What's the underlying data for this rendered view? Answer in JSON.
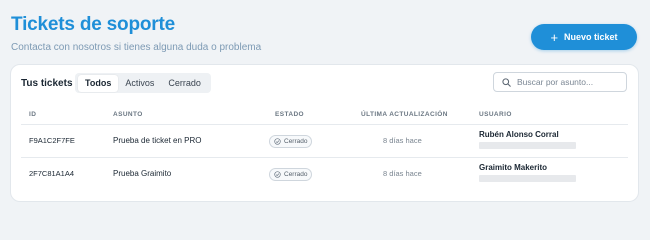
{
  "header": {
    "title": "Tickets de soporte",
    "subtitle": "Contacta con nosotros si tienes alguna duda o problema",
    "new_ticket_label": "Nuevo ticket"
  },
  "card": {
    "title": "Tus tickets",
    "tabs": [
      {
        "label": "Todos",
        "active": true
      },
      {
        "label": "Activos",
        "active": false
      },
      {
        "label": "Cerrado",
        "active": false
      }
    ],
    "search": {
      "placeholder": "Buscar por asunto...",
      "value": ""
    }
  },
  "table": {
    "columns": [
      "ID",
      "ASUNTO",
      "ESTADO",
      "ÚLTIMA ACTUALIZACIÓN",
      "USUARIO"
    ],
    "rows": [
      {
        "id": "F9A1C2F7FE",
        "subject": "Prueba de ticket en PRO",
        "status": "Cerrado",
        "updated": "8 días hace",
        "user": "Rubén Alonso Corral"
      },
      {
        "id": "2F7C81A1A4",
        "subject": "Prueba Graimito",
        "status": "Cerrado",
        "updated": "8 días hace",
        "user": "Graimito Makerito"
      }
    ]
  },
  "colors": {
    "accent": "#1f8fd8",
    "background": "#f0f3f6"
  }
}
